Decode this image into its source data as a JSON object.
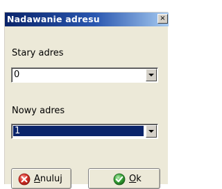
{
  "window": {
    "title": "Nadawanie adresu",
    "close_glyph": "×"
  },
  "old_address": {
    "label": "Stary adres",
    "value": "0"
  },
  "new_address": {
    "label": "Nowy adres",
    "value": "1"
  },
  "buttons": {
    "cancel": {
      "mnemonic": "A",
      "rest": "nuluj",
      "icon": "cancel-icon"
    },
    "ok": {
      "mnemonic": "O",
      "rest": "k",
      "icon": "ok-icon"
    }
  },
  "colors": {
    "titlebar_start": "#0a246a",
    "titlebar_end": "#a6caf0",
    "dialog_background": "#ece9d8",
    "selection_background": "#0a246a",
    "cancel_icon": "#d9342b",
    "ok_icon": "#3aa63a"
  }
}
